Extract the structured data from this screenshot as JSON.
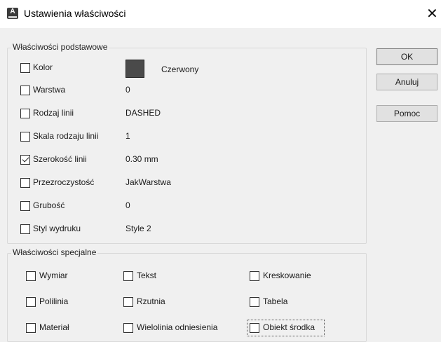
{
  "window": {
    "title": "Ustawienia właściwości",
    "app_icon": "A",
    "close_glyph": "✕"
  },
  "basic_group": {
    "title": "Właściwości podstawowe",
    "items": [
      {
        "label": "Kolor",
        "value": "Czerwony",
        "checked": false,
        "swatch_color": "#4a4a4a"
      },
      {
        "label": "Warstwa",
        "value": "0",
        "checked": false
      },
      {
        "label": "Rodzaj linii",
        "value": "DASHED",
        "checked": false
      },
      {
        "label": "Skala rodzaju linii",
        "value": "1",
        "checked": false
      },
      {
        "label": "Szerokość linii",
        "value": "0.30 mm",
        "checked": true
      },
      {
        "label": "Przezroczystość",
        "value": "JakWarstwa",
        "checked": false
      },
      {
        "label": "Grubość",
        "value": "0",
        "checked": false
      },
      {
        "label": "Styl wydruku",
        "value": "Style 2",
        "checked": false
      }
    ]
  },
  "special_group": {
    "title": "Właściwości specjalne",
    "items": [
      {
        "label": "Wymiar",
        "checked": false
      },
      {
        "label": "Tekst",
        "checked": false
      },
      {
        "label": "Kreskowanie",
        "checked": false
      },
      {
        "label": "Polilinia",
        "checked": false
      },
      {
        "label": "Rzutnia",
        "checked": false
      },
      {
        "label": "Tabela",
        "checked": false
      },
      {
        "label": "Materiał",
        "checked": false
      },
      {
        "label": "Wielolinia odniesienia",
        "checked": false
      },
      {
        "label": "Obiekt środka",
        "checked": false
      }
    ]
  },
  "buttons": {
    "ok": "OK",
    "cancel": "Anuluj",
    "help": "Pomoc"
  }
}
